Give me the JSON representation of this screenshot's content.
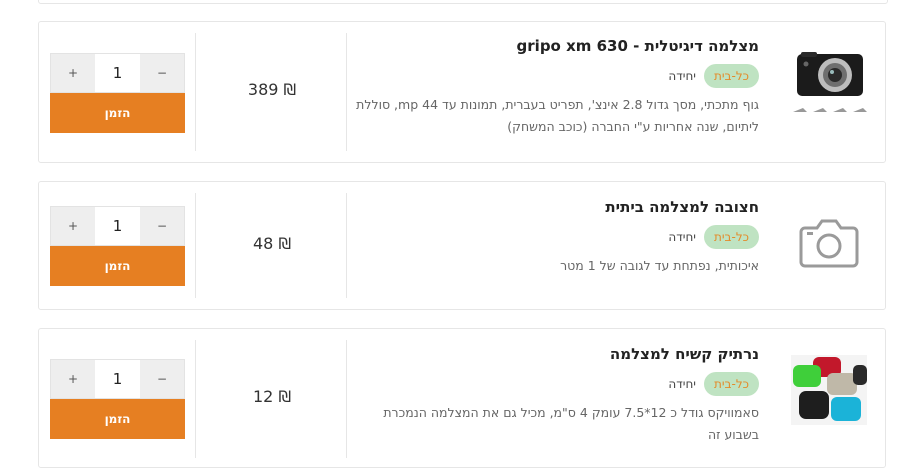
{
  "products": [
    {
      "title": "מצלמה דיגיטלית - gripo xm 630",
      "badge": "כל-בית",
      "unit": "יחידה",
      "description": "גוף מתכתי, מסך גדול 2.8 אינצ', תפריט בעברית, תמונות עד 44 mp, סוללת ליתיום, שנה אחריות ע\"י החברה (כוכב המשחק)",
      "price": "389 ₪",
      "quantity": "1",
      "minus_label": "−",
      "plus_label": "+",
      "order_label": "הזמן",
      "image": "digital-camera-photo"
    },
    {
      "title": "חצובה למצלמה ביתית",
      "badge": "כל-בית",
      "unit": "יחידה",
      "description": "איכותית, נפתחת עד לגובה של 1 מטר",
      "price": "48 ₪",
      "quantity": "1",
      "minus_label": "−",
      "plus_label": "+",
      "order_label": "הזמן",
      "image": "camera-placeholder-icon"
    },
    {
      "title": "נרתיק קשיח למצלמה",
      "badge": "כל-בית",
      "unit": "יחידה",
      "description": "סאמוויקס גודל כ 12*7.5 עומק 4 ס\"מ, מכיל גם את המצלמה הנמכרת בשבוע זה",
      "price": "12 ₪",
      "quantity": "1",
      "minus_label": "−",
      "plus_label": "+",
      "order_label": "הזמן",
      "image": "hard-case-photo"
    }
  ],
  "colors": {
    "accent": "#e67f22",
    "badge_bg": "#bfe3c2",
    "badge_text": "#e38b2b"
  }
}
